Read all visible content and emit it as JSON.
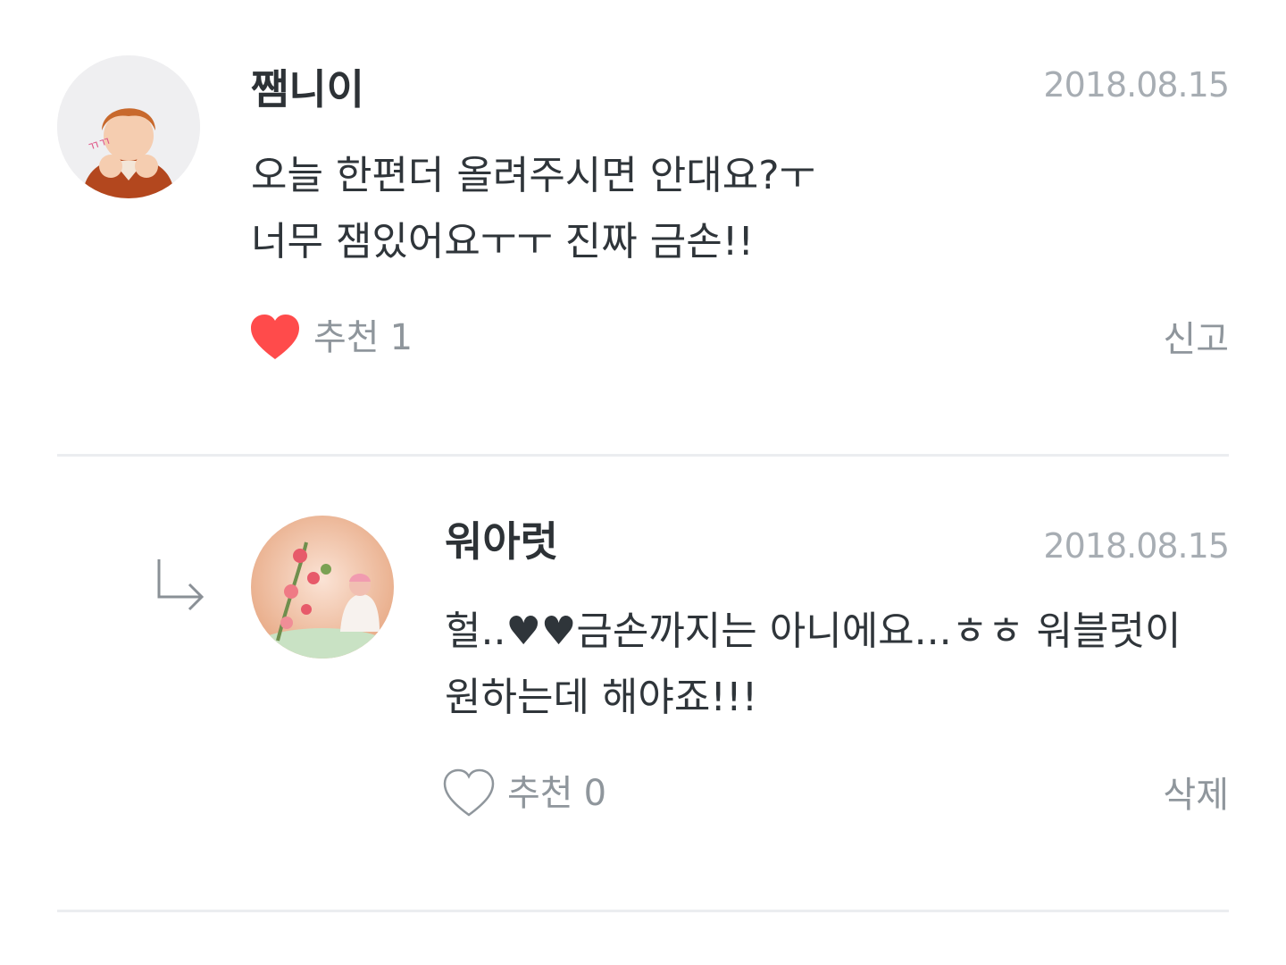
{
  "comments": [
    {
      "author": "쨈니이",
      "date": "2018.08.15",
      "body_lines": [
        "오늘 한편더 올려주시면 안대요?ㅜ",
        "너무 잼있어요ㅜㅜ 진짜 금손!!"
      ],
      "like_label": "추천",
      "like_count": "1",
      "liked": true,
      "action_label": "신고",
      "avatar_icon": "profile-photo"
    },
    {
      "author": "워아럿",
      "date": "2018.08.15",
      "body_lines": [
        "헐..♥♥금손까지는 아니에요...ㅎㅎ 워블럿이",
        "원하는데 해야죠!!!"
      ],
      "like_label": "추천",
      "like_count": "0",
      "liked": false,
      "action_label": "삭제",
      "avatar_icon": "profile-photo",
      "reply_icon": "reply-arrow-icon"
    }
  ],
  "colors": {
    "heart_filled": "#ff4b4b",
    "heart_outline": "#8f969c",
    "date": "#a7adb3",
    "divider": "#ebedf0"
  }
}
